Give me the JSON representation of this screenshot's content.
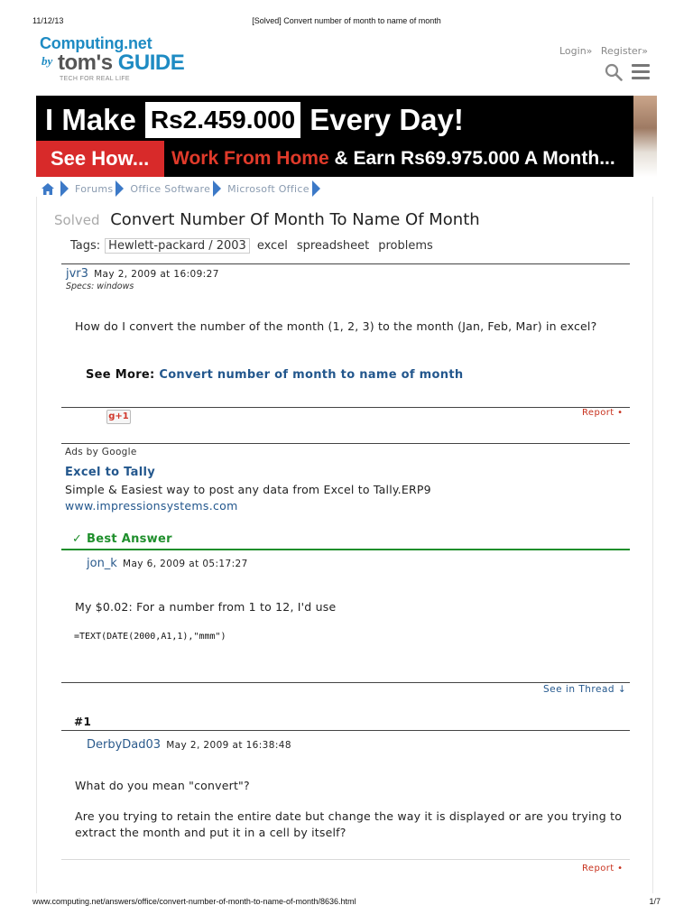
{
  "print": {
    "date": "11/12/13",
    "title": "[Solved] Convert number of month to name of month",
    "url": "www.computing.net/answers/office/convert-number-of-month-to-name-of-month/8636.html",
    "page": "1/7"
  },
  "logo": {
    "top": "Computing.net",
    "by": "by",
    "toms": "tom's",
    "guide": "GUIDE",
    "tagline": "TECH FOR REAL LIFE"
  },
  "header": {
    "login": "Login»",
    "register": "Register»",
    "search_icon": "search-icon",
    "menu_icon": "menu-icon"
  },
  "banner": {
    "line1_left": "I Make",
    "line1_amount": "Rs2.459.000",
    "line1_right": "Every Day!",
    "see_how": "See How...",
    "work_from_home": "Work From Home",
    "earn_text": "& Earn Rs69.975.000 A Month...",
    "accent_red": "#d82a2a"
  },
  "breadcrumb": {
    "home_icon": "home-icon",
    "items": [
      "Forums",
      "Office Software",
      "Microsoft Office"
    ]
  },
  "thread": {
    "status": "Solved",
    "title": "Convert Number Of Month To Name Of Month",
    "tags_label": "Tags:",
    "tags": [
      "Hewlett-packard / 2003",
      "excel",
      "spreadsheet",
      "problems"
    ]
  },
  "question": {
    "user": "jvr3",
    "date": "May 2, 2009 at 16:09:27",
    "specs": "Specs: windows",
    "body": "How do I convert the number of the month (1, 2, 3) to the month (Jan, Feb, Mar) in excel?",
    "see_more_label": "See More:",
    "see_more_link": "Convert number of month to name of month",
    "gplus": "g+1",
    "report": "Report •"
  },
  "ad": {
    "label": "Ads by Google",
    "title": "Excel to Tally",
    "description": "Simple & Easiest way to post any data from Excel to Tally.ERP9",
    "url": "www.impressionsystems.com"
  },
  "best_answer": {
    "label": "✓ Best Answer",
    "user": "jon_k",
    "date": "May 6, 2009 at 05:17:27",
    "body": "My $0.02: For a number from 1 to 12, I'd use",
    "code": "=TEXT(DATE(2000,A1,1),\"mmm\")",
    "see_thread": "See in Thread ↓",
    "accent_green": "#1f8f2c"
  },
  "reply1": {
    "number": "#1",
    "user": "DerbyDad03",
    "date": "May 2, 2009 at 16:38:48",
    "para1": "What do you mean \"convert\"?",
    "para2": "Are you trying to retain the entire date but change the way it is displayed or are you trying to extract the month and put it in a cell by itself?",
    "report": "Report •"
  }
}
